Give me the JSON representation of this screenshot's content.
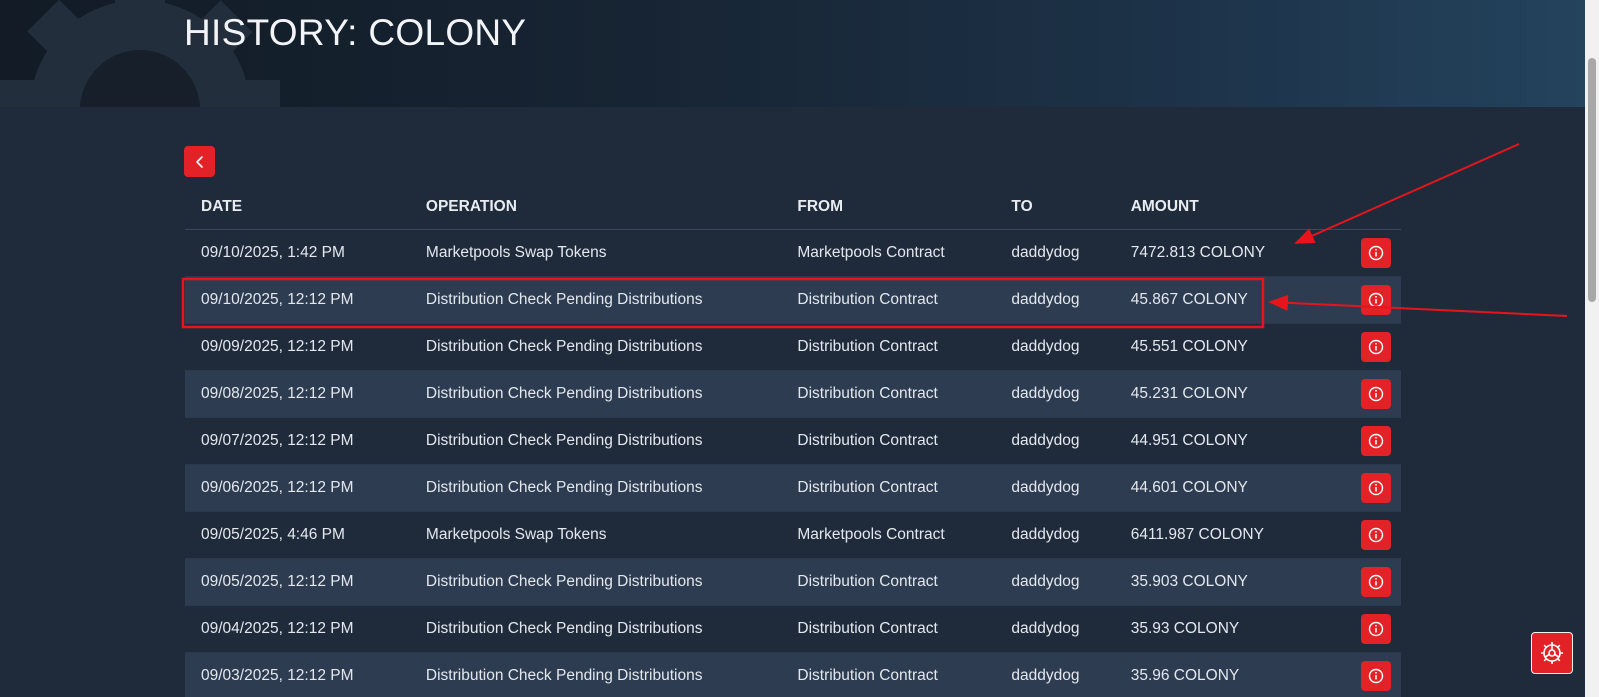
{
  "header": {
    "title": "HISTORY: COLONY"
  },
  "back_button": {
    "icon": "chevron-left-icon"
  },
  "table": {
    "columns": [
      "DATE",
      "OPERATION",
      "FROM",
      "TO",
      "AMOUNT"
    ],
    "rows": [
      {
        "date": "09/10/2025, 1:42 PM",
        "operation": "Marketpools Swap Tokens",
        "from": "Marketpools Contract",
        "to": "daddydog",
        "amount": "7472.813 COLONY"
      },
      {
        "date": "09/10/2025, 12:12 PM",
        "operation": "Distribution Check Pending Distributions",
        "from": "Distribution Contract",
        "to": "daddydog",
        "amount": "45.867 COLONY"
      },
      {
        "date": "09/09/2025, 12:12 PM",
        "operation": "Distribution Check Pending Distributions",
        "from": "Distribution Contract",
        "to": "daddydog",
        "amount": "45.551 COLONY"
      },
      {
        "date": "09/08/2025, 12:12 PM",
        "operation": "Distribution Check Pending Distributions",
        "from": "Distribution Contract",
        "to": "daddydog",
        "amount": "45.231 COLONY"
      },
      {
        "date": "09/07/2025, 12:12 PM",
        "operation": "Distribution Check Pending Distributions",
        "from": "Distribution Contract",
        "to": "daddydog",
        "amount": "44.951 COLONY"
      },
      {
        "date": "09/06/2025, 12:12 PM",
        "operation": "Distribution Check Pending Distributions",
        "from": "Distribution Contract",
        "to": "daddydog",
        "amount": "44.601 COLONY"
      },
      {
        "date": "09/05/2025, 4:46 PM",
        "operation": "Marketpools Swap Tokens",
        "from": "Marketpools Contract",
        "to": "daddydog",
        "amount": "6411.987 COLONY"
      },
      {
        "date": "09/05/2025, 12:12 PM",
        "operation": "Distribution Check Pending Distributions",
        "from": "Distribution Contract",
        "to": "daddydog",
        "amount": "35.903 COLONY"
      },
      {
        "date": "09/04/2025, 12:12 PM",
        "operation": "Distribution Check Pending Distributions",
        "from": "Distribution Contract",
        "to": "daddydog",
        "amount": "35.93 COLONY"
      },
      {
        "date": "09/03/2025, 12:12 PM",
        "operation": "Distribution Check Pending Distributions",
        "from": "Distribution Contract",
        "to": "daddydog",
        "amount": "35.96 COLONY"
      }
    ],
    "row_action_icon": "info-icon"
  },
  "settings_button": {
    "icon": "gear-icon"
  },
  "annotations": {
    "highlighted_row": 1,
    "color": "#e8141b"
  },
  "colors": {
    "accent": "#e32227",
    "background": "#1f2b3b",
    "row_stripe": "#2d3c50"
  }
}
